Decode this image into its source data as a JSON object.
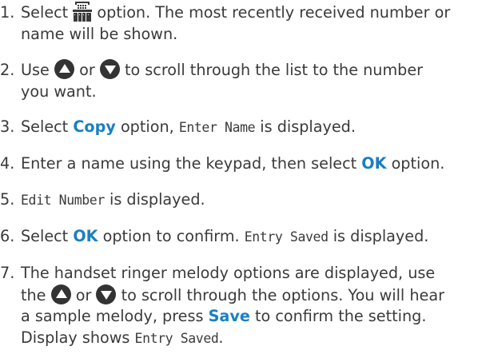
{
  "steps": [
    {
      "num": "1.",
      "a": "Select",
      "b": "option. The most recently received number or",
      "c": "name will be shown."
    },
    {
      "num": "2.",
      "a": "Use",
      "b": "or",
      "c": "to scroll through the list to the number",
      "d": "you want."
    },
    {
      "num": "3.",
      "a": "Select",
      "kw": "Copy",
      "b": "option,",
      "lcd": "Enter Name",
      "c": "is displayed."
    },
    {
      "num": "4.",
      "a": "Enter a name using the keypad, then select",
      "kw": "OK",
      "b": "option."
    },
    {
      "num": "5.",
      "lcd": "Edit Number",
      "a": "is displayed."
    },
    {
      "num": "6.",
      "a": "Select",
      "kw": "OK",
      "b": "option to confirm.",
      "lcd": "Entry Saved",
      "c": "is displayed."
    },
    {
      "num": "7.",
      "a": "The handset ringer melody options are displayed, use",
      "b": "the",
      "c": "or",
      "d": "to scroll through the options. You will hear",
      "e": "a sample melody, press",
      "kw": "Save",
      "f": "to confirm the setting.",
      "g": "Display shows",
      "lcd": "Entry Saved",
      "h": "."
    }
  ],
  "icons": {
    "calls_list": "calls-list-icon",
    "up": "up-arrow-icon",
    "down": "down-arrow-icon"
  },
  "colors": {
    "text": "#3a3a3a",
    "keyword": "#1b7fc3",
    "arrow_button": "#333333"
  }
}
